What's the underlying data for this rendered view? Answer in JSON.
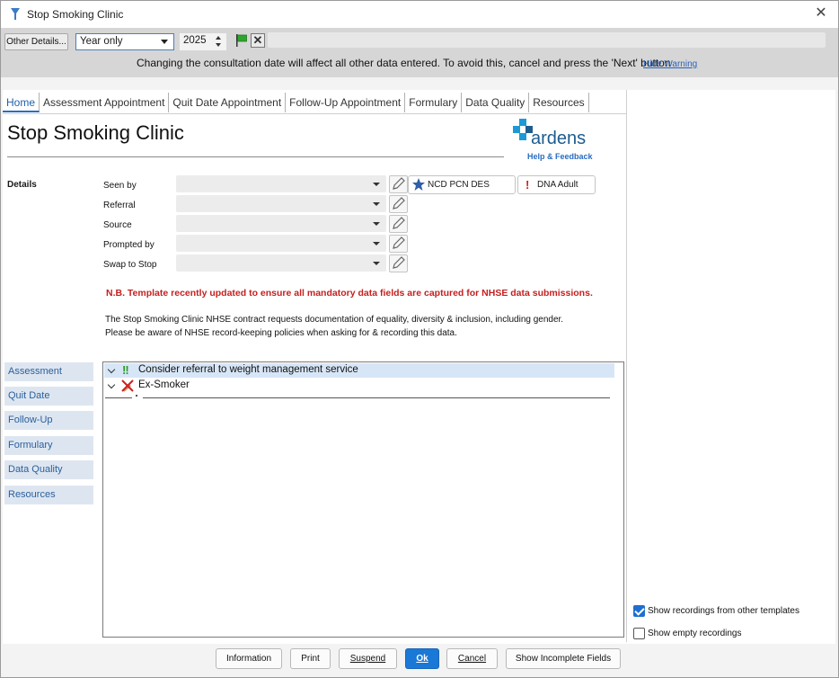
{
  "window": {
    "title": "Stop Smoking Clinic",
    "close_icon": "close-icon"
  },
  "toolbar": {
    "other_details": "Other Details...",
    "period_selected": "Year only",
    "year": "2025",
    "warning": "Changing the consultation date will affect all other data entered. To avoid this, cancel and press the 'Next' button",
    "hide_warning": "Hide Warning"
  },
  "tabs": [
    {
      "label": "Home"
    },
    {
      "label": "Assessment Appointment"
    },
    {
      "label": "Quit Date Appointment"
    },
    {
      "label": "Follow-Up Appointment"
    },
    {
      "label": "Formulary"
    },
    {
      "label": "Data Quality"
    },
    {
      "label": "Resources"
    }
  ],
  "page": {
    "title": "Stop Smoking Clinic",
    "logo": {
      "word": "ardens",
      "help": "Help & Feedback"
    }
  },
  "details": {
    "label": "Details",
    "rows": [
      {
        "label": "Seen by"
      },
      {
        "label": "Referral"
      },
      {
        "label": "Source"
      },
      {
        "label": "Prompted by"
      },
      {
        "label": "Swap to Stop"
      }
    ],
    "badges": {
      "ncd": "NCD PCN DES",
      "dna": "DNA Adult"
    }
  },
  "notes": {
    "nb": "N.B. Template recently updated to ensure all mandatory data fields are captured for NHSE data submissions.",
    "info_line1": "The Stop Smoking Clinic NHSE contract requests documentation of equality, diversity & inclusion, including gender.",
    "info_line2": "Please be aware of NHSE record-keeping policies when asking for & recording this data."
  },
  "side_nav": [
    {
      "label": "Assessment"
    },
    {
      "label": "Quit Date"
    },
    {
      "label": "Follow-Up"
    },
    {
      "label": "Formulary"
    },
    {
      "label": "Data Quality"
    },
    {
      "label": "Resources"
    }
  ],
  "tree": {
    "items": [
      {
        "label": "Consider referral to weight management service"
      },
      {
        "label": "Ex-Smoker"
      }
    ]
  },
  "options": {
    "show_other": "Show recordings from other templates",
    "show_other_checked": true,
    "show_empty": "Show empty recordings",
    "show_empty_checked": false
  },
  "footer": {
    "information": "Information",
    "print": "Print",
    "suspend": "Suspend",
    "ok": "Ok",
    "cancel": "Cancel",
    "incomplete": "Show Incomplete Fields"
  },
  "colors": {
    "accent": "#1a78d6",
    "warning_red": "#c62020",
    "logo_blue": "#1d5c8f"
  }
}
